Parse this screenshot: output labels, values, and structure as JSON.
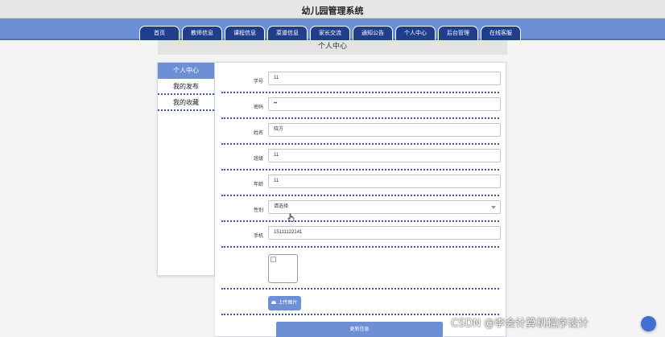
{
  "app": {
    "title": "幼儿园管理系统"
  },
  "nav": {
    "items": [
      {
        "label": "首页"
      },
      {
        "label": "教师信息"
      },
      {
        "label": "课程信息"
      },
      {
        "label": "菜谱信息"
      },
      {
        "label": "家长交流"
      },
      {
        "label": "通知公告"
      },
      {
        "label": "个人中心"
      },
      {
        "label": "后台管理"
      },
      {
        "label": "在线客服"
      }
    ]
  },
  "page": {
    "heading": "个人中心"
  },
  "sidebar": {
    "items": [
      {
        "label": "个人中心",
        "active": true
      },
      {
        "label": "我的发布",
        "active": false
      },
      {
        "label": "我的收藏",
        "active": false
      }
    ]
  },
  "form": {
    "fields": [
      {
        "label": "学号",
        "value": "11"
      },
      {
        "label": "密码",
        "value": "••"
      },
      {
        "label": "姓名",
        "value": "晓方"
      },
      {
        "label": "班级",
        "value": "11"
      },
      {
        "label": "年龄",
        "value": "11"
      },
      {
        "label": "性别",
        "value": "请选择"
      },
      {
        "label": "手机",
        "value": "15111122141"
      }
    ],
    "upload_label": "上传图片",
    "submit_label": "更新信息"
  },
  "colors": {
    "accent": "#6d8fd6",
    "nav_tab": "#1f3f8c",
    "divider": "#3c5aa6"
  },
  "watermark": {
    "text": "CSDN @李会计算机程序设计"
  }
}
